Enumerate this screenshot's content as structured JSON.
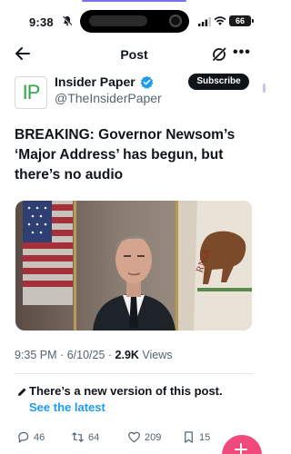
{
  "status_bar": {
    "time": "9:38",
    "battery": "66"
  },
  "header": {
    "title": "Post"
  },
  "author": {
    "avatar_text": "IP",
    "name": "Insider Paper",
    "handle": "@TheInsiderPaper",
    "subscribe_label": "Subscribe"
  },
  "post": {
    "text": "BREAKING: Governor Newsom’s ‘Major Address’ has begun, but there’s no audio",
    "time": "9:35 PM",
    "date": "6/10/25",
    "views_count": "2.9K",
    "views_label": "Views"
  },
  "notice": {
    "text": "There’s a new version of this post.",
    "link": "See the latest"
  },
  "actions": {
    "replies": "46",
    "reposts": "64",
    "likes": "209",
    "bookmarks": "15"
  },
  "colors": {
    "accent": "#1d9bf0",
    "text": "#0f1419",
    "muted": "#536471",
    "fab": "#f04a7d",
    "logo_green": "#2aa84a"
  }
}
